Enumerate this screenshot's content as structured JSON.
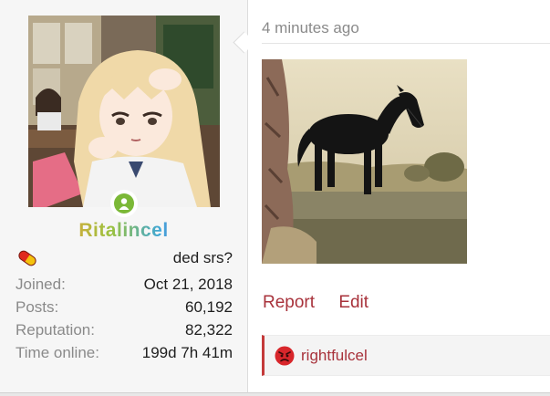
{
  "user": {
    "avatar_icon": "anime-avatar-image",
    "online_status_icon": "online-status-icon",
    "username": "Ritalincel",
    "title_icon": "pill-icon",
    "title": "ded srs?",
    "stats": [
      {
        "label": "Joined:",
        "value": "Oct 21, 2018"
      },
      {
        "label": "Posts:",
        "value": "60,192"
      },
      {
        "label": "Reputation:",
        "value": "82,322"
      },
      {
        "label": "Time online:",
        "value": "199d 7h 41m"
      }
    ]
  },
  "post": {
    "timestamp": "4 minutes ago",
    "image_icon": "horse-image",
    "actions": {
      "report": "Report",
      "edit": "Edit"
    },
    "reaction": {
      "icon": "angry-face-icon",
      "username": "rightfulcel"
    }
  },
  "colors": {
    "accent": "#a8323b",
    "online": "#7bb837"
  }
}
